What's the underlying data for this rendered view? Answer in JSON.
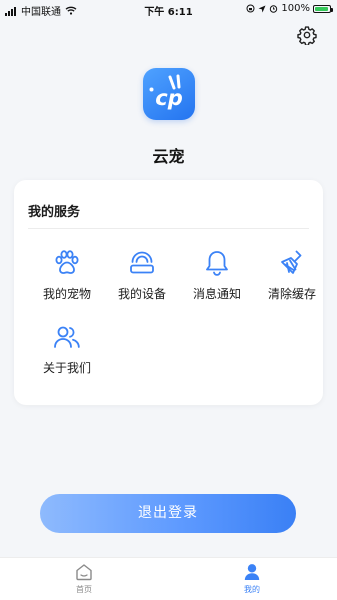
{
  "status_bar": {
    "carrier": "中国联通",
    "time": "下午 6:11",
    "battery": "100%"
  },
  "profile": {
    "app_name": "云宠",
    "logo_text": "cp"
  },
  "services": {
    "title": "我的服务",
    "items": [
      {
        "label": "我的宠物",
        "icon": "paw-icon"
      },
      {
        "label": "我的设备",
        "icon": "device-icon"
      },
      {
        "label": "消息通知",
        "icon": "bell-icon"
      },
      {
        "label": "清除缓存",
        "icon": "broom-icon"
      },
      {
        "label": "关于我们",
        "icon": "users-icon"
      }
    ]
  },
  "logout": {
    "label": "退出登录"
  },
  "tabbar": {
    "home_label": "首页",
    "mine_label": "我的"
  },
  "colors": {
    "accent": "#3b82f6",
    "background": "#f4f6f9",
    "card": "#ffffff"
  }
}
